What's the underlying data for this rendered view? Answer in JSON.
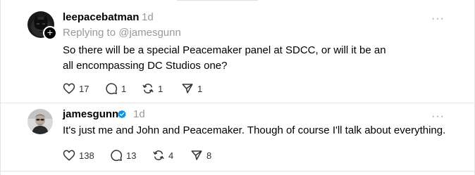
{
  "posts": [
    {
      "username": "leepacebatman",
      "time": "1d",
      "replying_to": "Replying to @jamesgunn",
      "text": "So there will be a special Peacemaker panel at SDCC, or will it be an all encompassing DC Studios one?",
      "likes": "17",
      "comments": "1",
      "reposts": "1",
      "shares": "1",
      "more_label": "···"
    },
    {
      "username": "jamesgunn",
      "verified": true,
      "time": "1d",
      "text": "It's just me and John and Peacemaker. Though of course I'll talk about everything.",
      "likes": "138",
      "comments": "13",
      "reposts": "4",
      "shares": "8",
      "more_label": "···"
    }
  ],
  "follow_badge": "+",
  "colors": {
    "verified": "#0095f6",
    "muted": "#999999",
    "divider": "#e6e6e6"
  }
}
